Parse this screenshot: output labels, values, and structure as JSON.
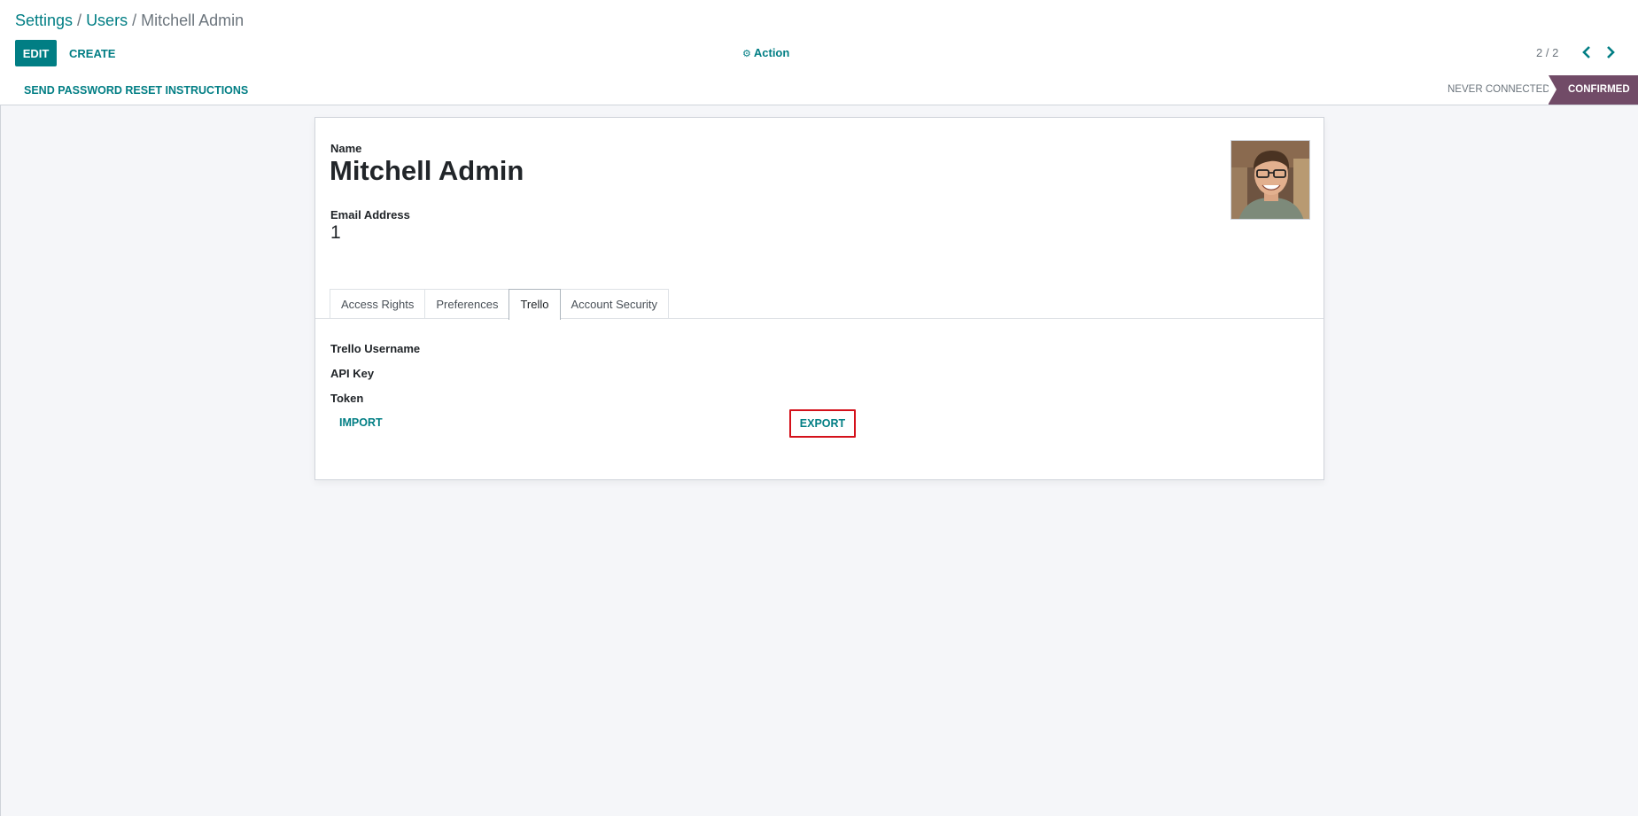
{
  "breadcrumb": {
    "items": [
      "Settings",
      "Users",
      "Mitchell Admin"
    ],
    "separator": "/"
  },
  "toolbar": {
    "edit_label": "EDIT",
    "create_label": "CREATE",
    "action_label": "Action",
    "pager_value": "2 / 2"
  },
  "statusbar": {
    "reset_label": "SEND PASSWORD RESET INSTRUCTIONS",
    "stages": [
      "NEVER CONNECTED",
      "CONFIRMED"
    ],
    "active_stage": "CONFIRMED"
  },
  "form": {
    "name_label": "Name",
    "name_value": "Mitchell Admin",
    "email_label": "Email Address",
    "email_value": "1",
    "tabs": [
      {
        "label": "Access Rights",
        "active": false
      },
      {
        "label": "Preferences",
        "active": false
      },
      {
        "label": "Trello",
        "active": true
      },
      {
        "label": "Account Security",
        "active": false
      }
    ],
    "trello": {
      "username_label": "Trello Username",
      "username_value": "",
      "api_key_label": "API Key",
      "api_key_value": "",
      "token_label": "Token",
      "token_value": ""
    },
    "import_label": "IMPORT",
    "export_label": "EXPORT"
  },
  "colors": {
    "primary": "#017e84",
    "status_active": "#714b67",
    "highlight_border": "#d4111b"
  },
  "icons": {
    "action": "gear-icon",
    "pager_prev": "chevron-left-icon",
    "pager_next": "chevron-right-icon"
  }
}
